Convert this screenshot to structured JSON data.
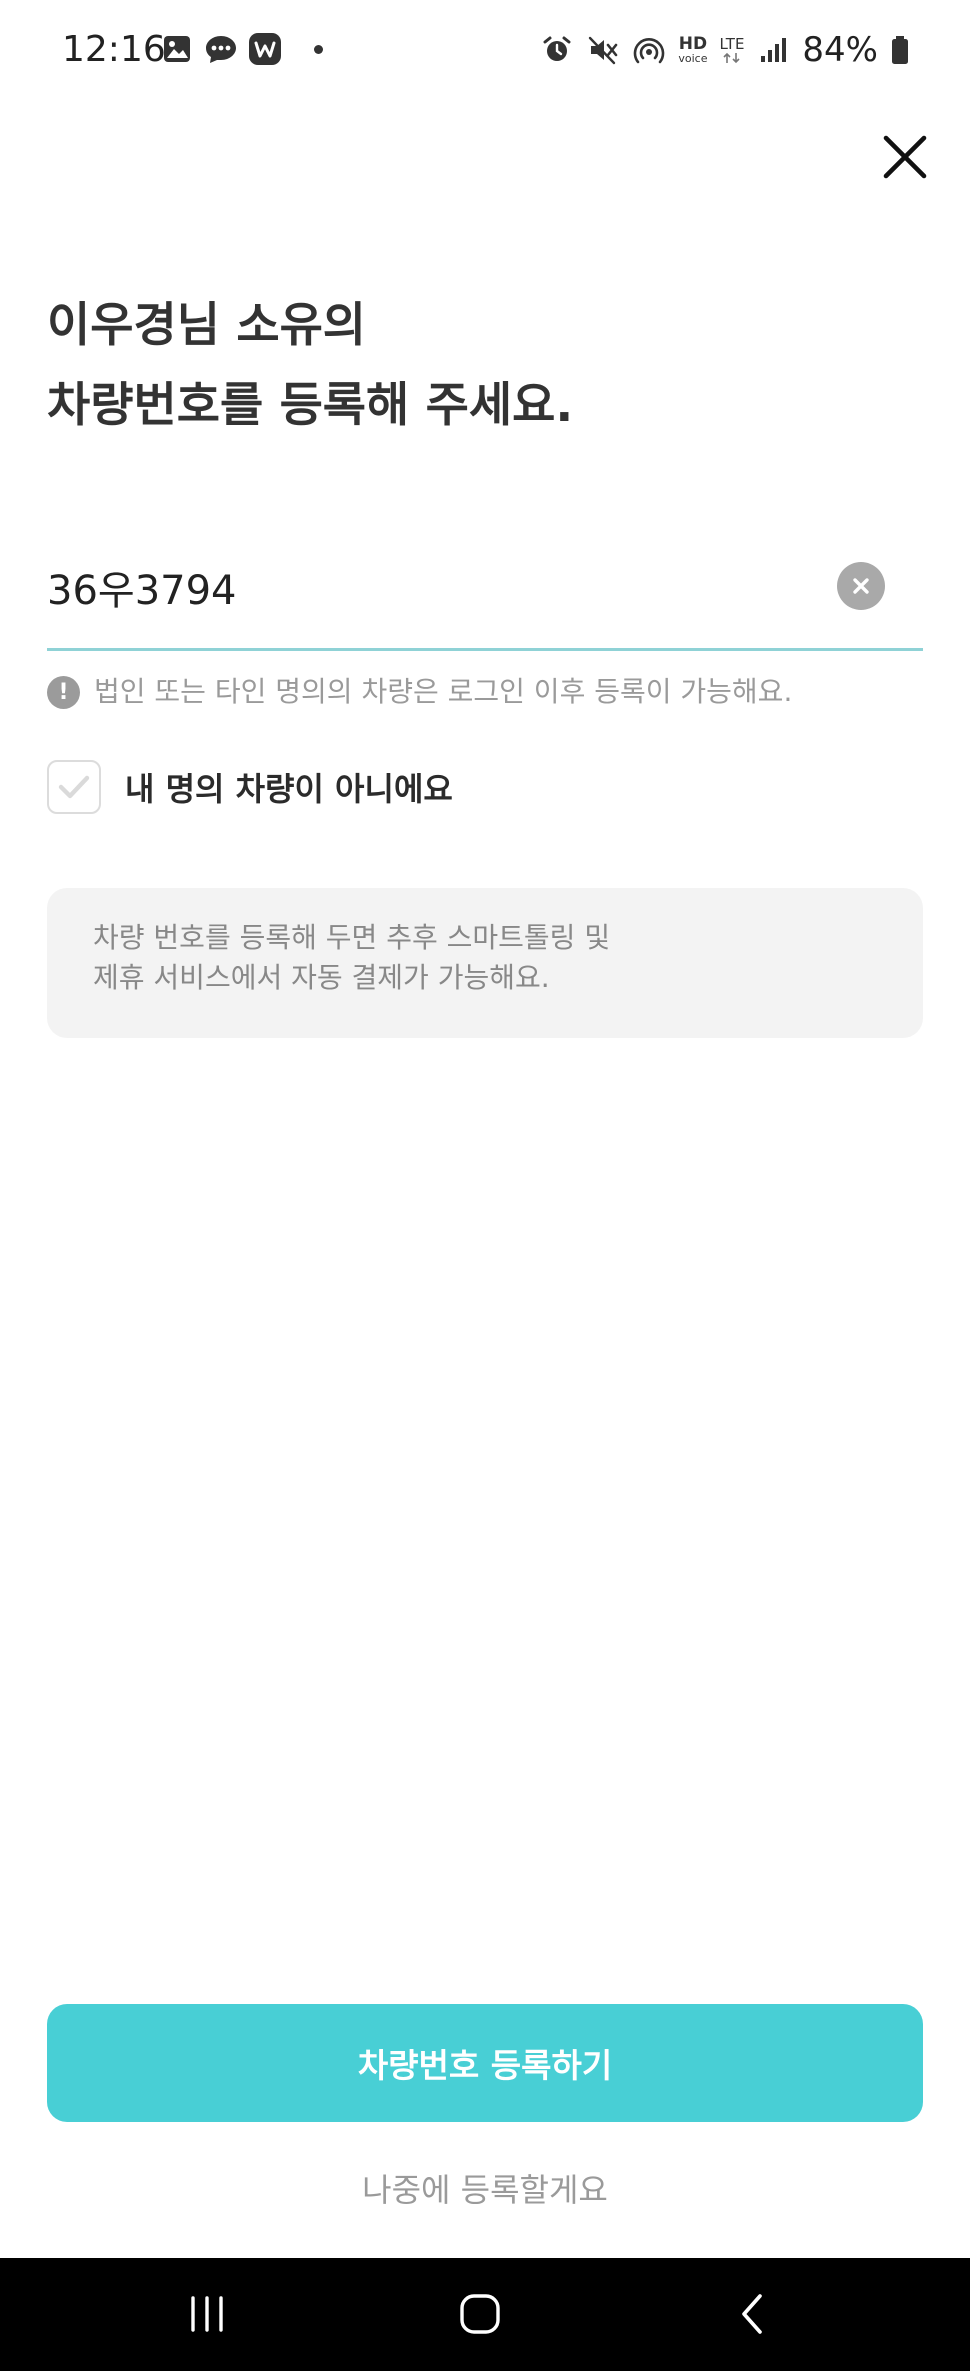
{
  "status_bar": {
    "time": "12:16",
    "left_icons": [
      "gallery-icon",
      "chat-bubble-icon",
      "app-w-icon",
      "notification-dot-icon"
    ],
    "right_icons": [
      "alarm-icon",
      "mute-icon",
      "hotspot-icon",
      "hd-voice-icon",
      "lte-icon",
      "signal-icon",
      "battery-icon"
    ],
    "hd_label": "HD",
    "voice_label": "voice",
    "lte_label": "LTE",
    "battery": "84%"
  },
  "header": {
    "close_icon": "close-icon"
  },
  "title": {
    "line1": "이우경님 소유의",
    "line2": "차량번호를 등록해 주세요."
  },
  "plate_input": {
    "value": "36우3794",
    "clear_icon": "clear-icon"
  },
  "notice": {
    "icon": "exclamation-icon",
    "text": "법인 또는 타인 명의의 차량은 로그인 이후 등록이 가능해요."
  },
  "checkbox": {
    "label": "내 명의 차량이 아니에요",
    "checked": false
  },
  "info_card": {
    "line1": "차량 번호를 등록해 두면 추후 스마트톨링 및",
    "line2": "제휴 서비스에서 자동 결제가 가능해요."
  },
  "actions": {
    "primary_label": "차량번호 등록하기",
    "later_label": "나중에 등록할게요"
  },
  "colors": {
    "accent": "#48cfd5",
    "underline": "#8fd2d6",
    "card_bg": "#f3f3f3",
    "muted_text": "#9a9a9a"
  },
  "nav_bar": {
    "items": [
      "recent-apps-icon",
      "home-icon",
      "back-icon"
    ]
  }
}
